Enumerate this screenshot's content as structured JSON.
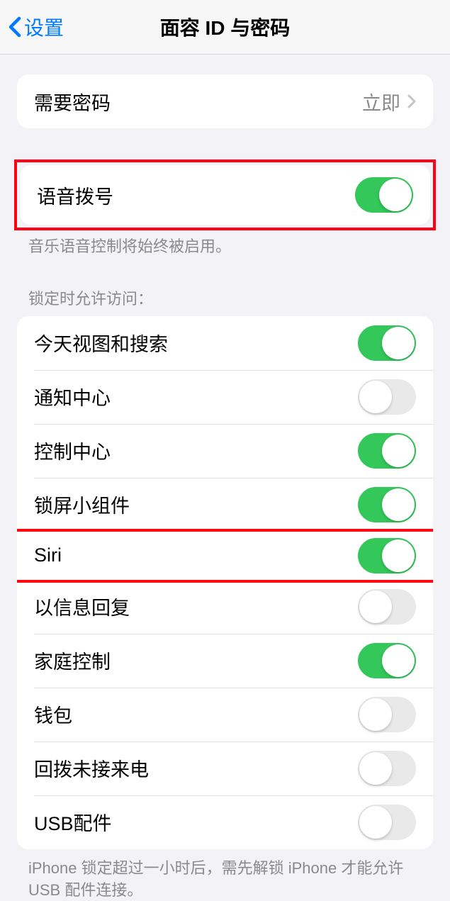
{
  "nav": {
    "back_label": "设置",
    "title": "面容 ID 与密码"
  },
  "require_passcode": {
    "label": "需要密码",
    "value": "立即"
  },
  "voice_dial": {
    "label": "语音拨号",
    "footer": "音乐语音控制将始终被启用。"
  },
  "allow_access_header": "锁定时允许访问：",
  "rows": {
    "today": "今天视图和搜索",
    "notification": "通知中心",
    "control": "控制中心",
    "widgets": "锁屏小组件",
    "siri": "Siri",
    "reply": "以信息回复",
    "home": "家庭控制",
    "wallet": "钱包",
    "callback": "回拨未接来电",
    "usb": "USB配件"
  },
  "usb_footer": "iPhone 锁定超过一小时后，需先解锁 iPhone 才能允许 USB 配件连接。",
  "toggles": {
    "voice_dial": true,
    "today": true,
    "notification": false,
    "control": true,
    "widgets": true,
    "siri": true,
    "reply": false,
    "home": true,
    "wallet": false,
    "callback": false,
    "usb": false
  }
}
